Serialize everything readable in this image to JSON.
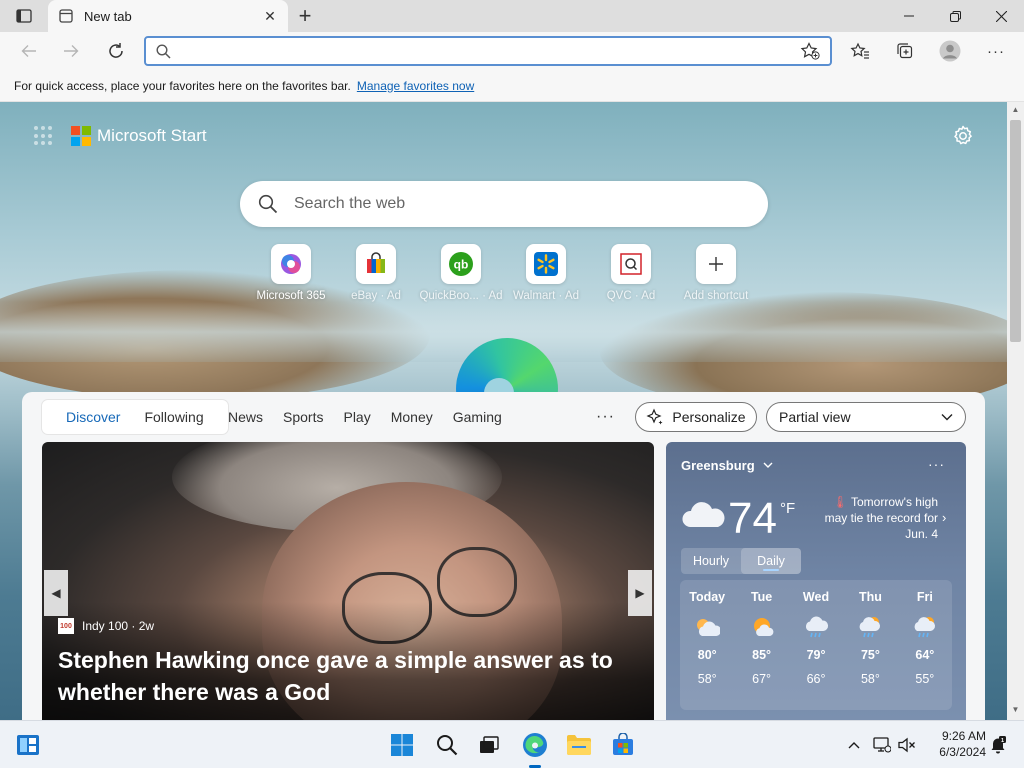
{
  "browser": {
    "tab_title": "New tab",
    "address_placeholder": "",
    "address_value": "",
    "favorites_bar_text": "For quick access, place your favorites here on the favorites bar.",
    "favorites_bar_link": "Manage favorites now"
  },
  "newtab": {
    "brand": "Microsoft Start",
    "search_placeholder": "Search the web",
    "shortcuts": [
      {
        "label": "Microsoft 365",
        "icon": "microsoft-365-icon"
      },
      {
        "label": "eBay · Ad",
        "icon": "ebay-icon"
      },
      {
        "label": "QuickBoo... · Ad",
        "icon": "quickbooks-icon"
      },
      {
        "label": "Walmart · Ad",
        "icon": "walmart-icon"
      },
      {
        "label": "QVC · Ad",
        "icon": "qvc-icon"
      },
      {
        "label": "Add shortcut",
        "icon": "plus-icon"
      }
    ]
  },
  "feed": {
    "tabs": [
      "Discover",
      "Following"
    ],
    "nav": [
      "News",
      "Sports",
      "Play",
      "Money",
      "Gaming"
    ],
    "more": "···",
    "personalize_label": "Personalize",
    "view_label": "Partial view",
    "hero": {
      "source_logo": "100",
      "source": "Indy 100 · 2w",
      "headline": "Stephen Hawking once gave a simple answer as to whether there was a God"
    }
  },
  "weather": {
    "location": "Greensburg",
    "temp": "74",
    "unit": "°F",
    "alert": "Tomorrow's high may tie the record for Jun. 4",
    "toggle": [
      "Hourly",
      "Daily"
    ],
    "days": [
      {
        "name": "Today",
        "high": "80°",
        "low": "58°",
        "icon": "partly-cloudy-icon"
      },
      {
        "name": "Tue",
        "high": "85°",
        "low": "67°",
        "icon": "sunny-cloud-icon"
      },
      {
        "name": "Wed",
        "high": "79°",
        "low": "66°",
        "icon": "rain-cloud-icon"
      },
      {
        "name": "Thu",
        "high": "75°",
        "low": "58°",
        "icon": "rain-sun-icon"
      },
      {
        "name": "Fri",
        "high": "64°",
        "low": "55°",
        "icon": "rain-sun-icon"
      }
    ]
  },
  "taskbar": {
    "time": "9:26 AM",
    "date": "6/3/2024"
  },
  "colors": {
    "accent": "#0067c0",
    "link": "#0f62b5",
    "feed_active": "#1769b8"
  }
}
